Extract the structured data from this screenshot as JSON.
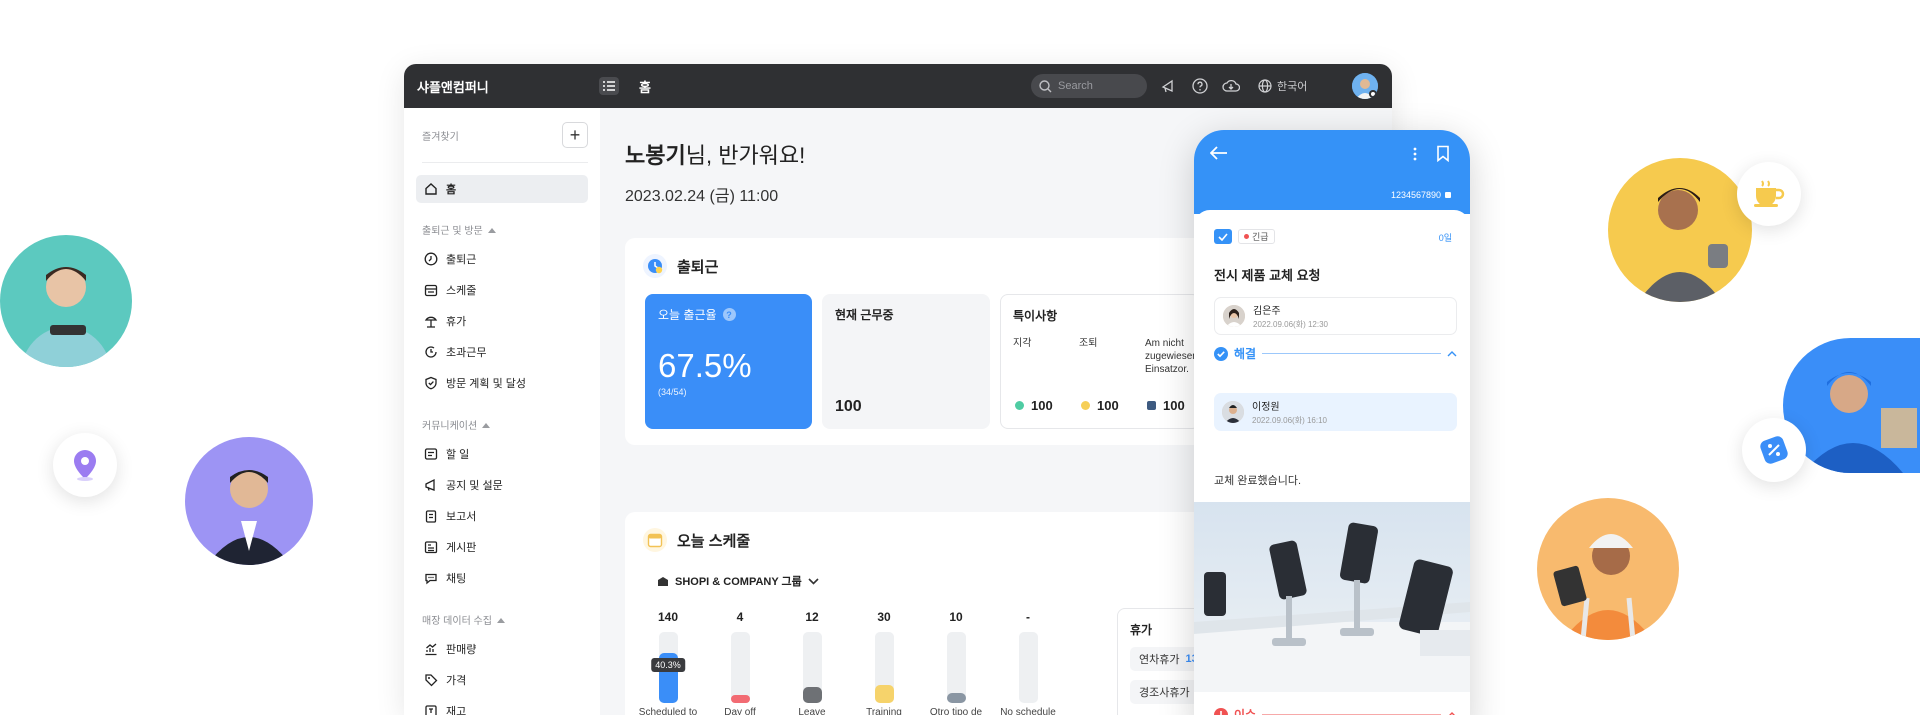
{
  "app": {
    "brand": "샤플앤컴퍼니",
    "breadcrumb": "홈",
    "search_placeholder": "Search",
    "language": "한국어"
  },
  "sidebar": {
    "favorites_label": "즐겨찾기",
    "home": "홈",
    "sections": [
      {
        "title": "출퇴근 및 방문",
        "items": [
          "출퇴근",
          "스케줄",
          "휴가",
          "초과근무",
          "방문 계획 및 달성"
        ]
      },
      {
        "title": "커뮤니케이션",
        "items": [
          "할 일",
          "공지 및 설문",
          "보고서",
          "게시판",
          "채팅"
        ]
      },
      {
        "title": "매장 데이터 수집",
        "items": [
          "판매량",
          "가격",
          "재고"
        ]
      }
    ]
  },
  "main": {
    "greeting_name": "노봉기",
    "greeting_rest": "님, 반가워요!",
    "date": "2023.02.24 (금) 11:00",
    "attendance": {
      "title": "출퇴근",
      "rate_title": "오늘 출근율",
      "rate_value": "67.5%",
      "rate_sub": "(34/54)",
      "working_title": "현재 근무중",
      "working_value": "100",
      "special_title": "특이사항",
      "special_cols": [
        {
          "label": "지각",
          "value": "100",
          "color": "#4fcca3"
        },
        {
          "label": "조퇴",
          "value": "100",
          "color": "#f6cf57"
        },
        {
          "label": "Am nicht zugewiesenen Einsatzor.",
          "value": "100",
          "color": "#3d5a80"
        }
      ]
    },
    "schedule": {
      "title": "오늘 스케줄",
      "group": "SHOPI & COMPANY 그룹",
      "tooltip": "40.3%",
      "bars": [
        {
          "value": "140",
          "label": "Scheduled to work",
          "fill": 0.7,
          "color": "#3a8ef8"
        },
        {
          "value": "4",
          "label": "Day off",
          "fill": 0.1,
          "color": "#f26b73"
        },
        {
          "value": "12",
          "label": "Leave",
          "fill": 0.22,
          "color": "#6e7175"
        },
        {
          "value": "30",
          "label": "Training",
          "fill": 0.25,
          "color": "#f6d36b"
        },
        {
          "value": "10",
          "label": "Otro tipo de trabajo",
          "fill": 0.14,
          "color": "#8a96a3"
        },
        {
          "value": "-",
          "label": "No schedule",
          "fill": 0,
          "color": "#eef0f2"
        }
      ],
      "leave_title": "휴가",
      "leave_rows": [
        {
          "label": "연차휴가",
          "value": "13"
        },
        {
          "label": "경조사휴가",
          "value": ""
        }
      ]
    }
  },
  "phone": {
    "number": "1234567890",
    "urgent": "긴급",
    "count": "0일",
    "title": "전시 제품 교체 요청",
    "requester_name": "김은주",
    "requester_date": "2022.09.06(화) 12:30",
    "resolved_label": "해결",
    "resolver_name": "이정원",
    "resolver_date": "2022.09.06(화) 16:10",
    "message": "교체 완료했습니다.",
    "issue_label": "이슈"
  },
  "colors": {
    "primary": "#3a8ef8",
    "topbar": "#2f3033",
    "issue": "#f05252"
  }
}
